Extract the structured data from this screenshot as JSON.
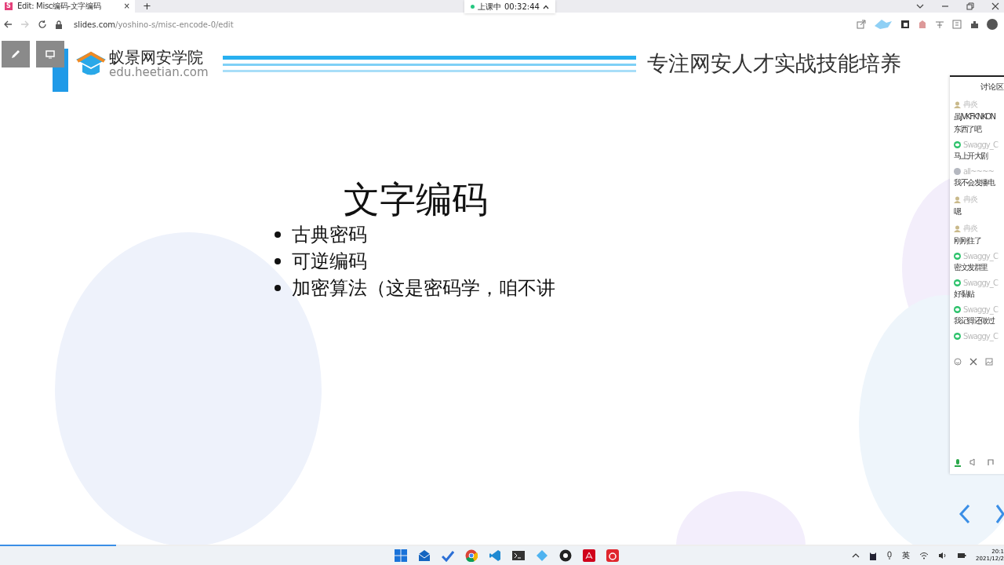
{
  "browser": {
    "tab": {
      "title": "Edit: Misc编码-文字编码",
      "favicon": "S",
      "close": "×",
      "selected": true
    },
    "new_tab": "+",
    "url": {
      "domain": "slides.com",
      "path": "/yoshino-s/misc-encode-0/edit"
    }
  },
  "class_status": {
    "label": "上课中",
    "time": "00:32:44"
  },
  "slide": {
    "logo": {
      "name": "蚁景网安学院",
      "domain": "edu.heetian.com"
    },
    "slogan": "专注网安人才实战技能培养",
    "title": "文字编码",
    "bullets": [
      "古典密码",
      "可逆编码",
      "加密算法（这是密码学，咱不讲"
    ],
    "progress": {
      "level": 0.116
    }
  },
  "chat": {
    "title": "讨论区",
    "messages": [
      {
        "user": "冉炎",
        "kind": "person",
        "lines": [
          "虽JVKFKNKON",
          "东西了吧"
        ]
      },
      {
        "user": "Swaggy_C",
        "kind": "wechat",
        "lines": [
          "马上开大剧"
        ]
      },
      {
        "user": "all~~~~",
        "kind": "grey",
        "lines": [
          "我不会发播电"
        ]
      },
      {
        "user": "冉炎",
        "kind": "person",
        "lines": [
          "嗯"
        ]
      },
      {
        "user": "冉炎",
        "kind": "person",
        "lines": [
          "刚刚住了"
        ]
      },
      {
        "user": "Swaggy_C",
        "kind": "wechat",
        "lines": [
          "密文发群里"
        ]
      },
      {
        "user": "Swaggy_C",
        "kind": "wechat",
        "lines": [
          "好黏贴"
        ]
      },
      {
        "user": "Swaggy_C",
        "kind": "wechat",
        "lines": [
          "我记得还做过"
        ]
      },
      {
        "user": "Swaggy_C",
        "kind": "wechat"
      }
    ]
  },
  "taskbar": {
    "ime": "英",
    "time": "20:1",
    "date": "2021/12/2"
  }
}
